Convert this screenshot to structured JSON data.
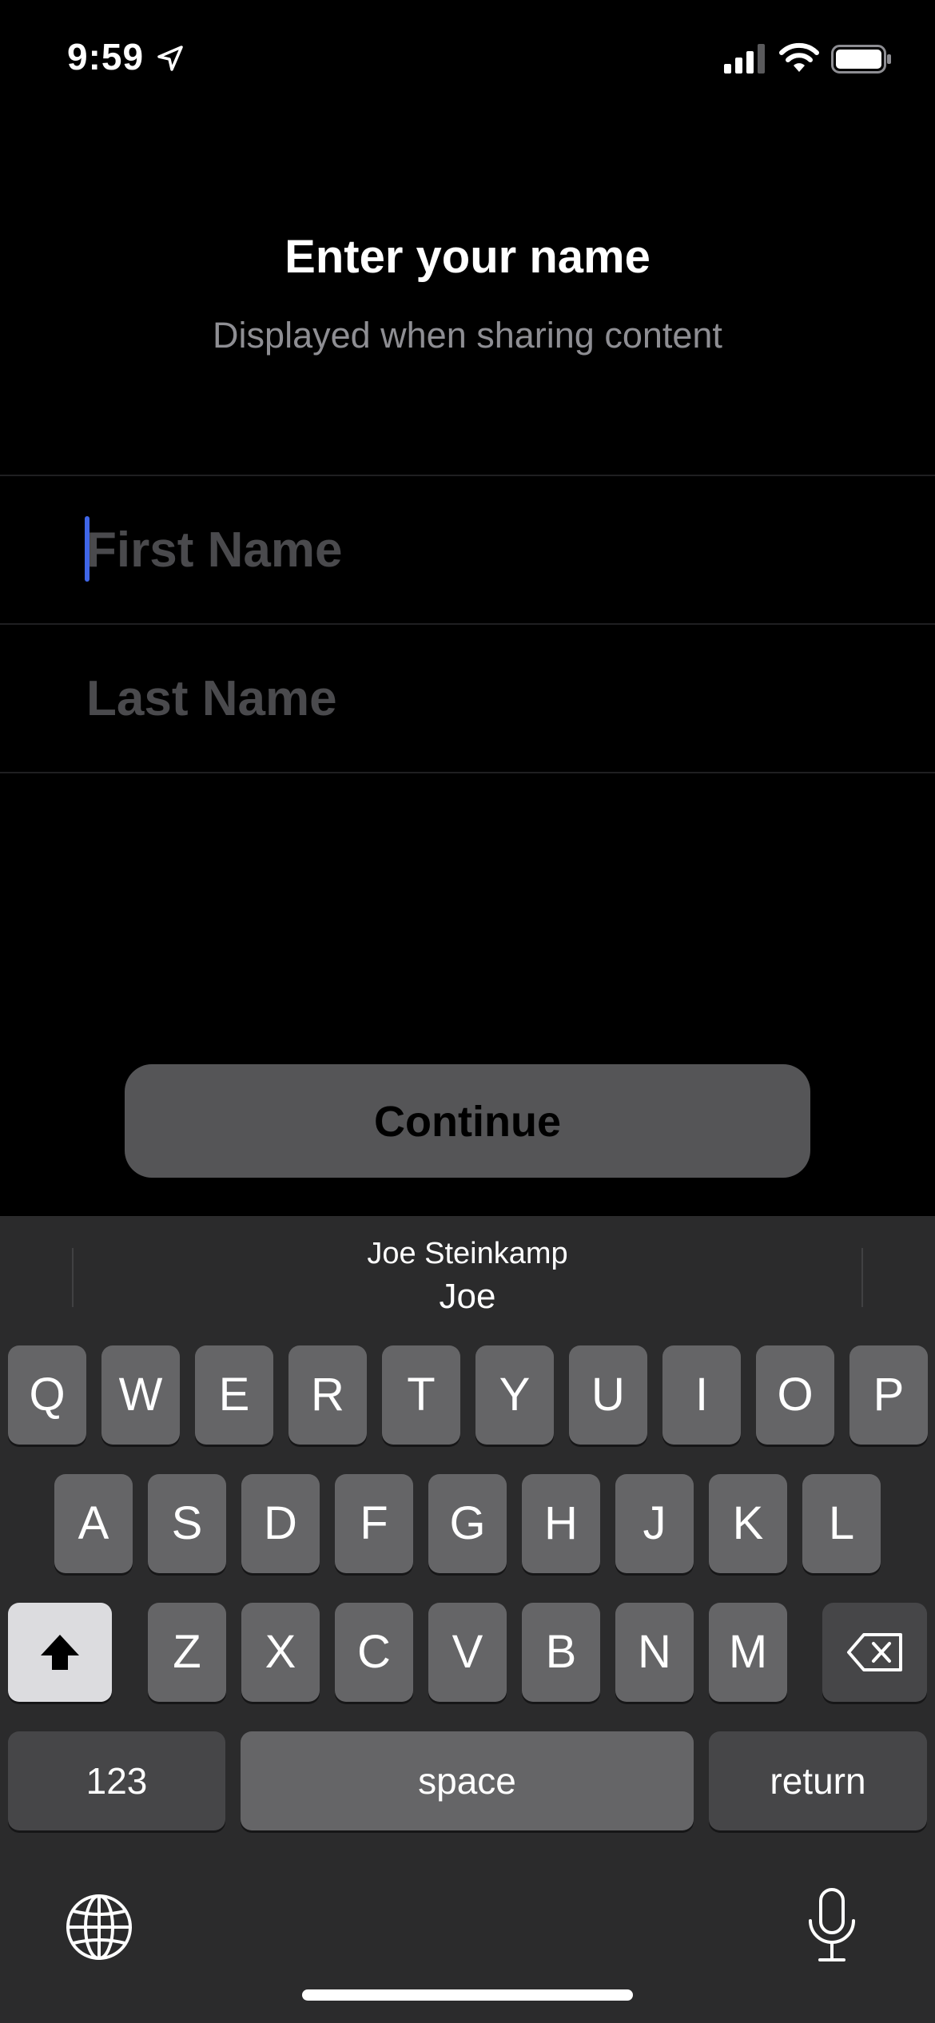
{
  "status_bar": {
    "time": "9:59",
    "icons": [
      "location-arrow-icon",
      "cellular-signal-icon",
      "wifi-icon",
      "battery-icon"
    ]
  },
  "header": {
    "title": "Enter your name",
    "subtitle": "Displayed when sharing content"
  },
  "form": {
    "first_name": {
      "value": "",
      "placeholder": "First Name"
    },
    "last_name": {
      "value": "",
      "placeholder": "Last Name"
    }
  },
  "continue_button": {
    "label": "Continue"
  },
  "keyboard": {
    "suggestions": {
      "contact": "Joe Steinkamp",
      "name": "Joe"
    },
    "row1": [
      "Q",
      "W",
      "E",
      "R",
      "T",
      "Y",
      "U",
      "I",
      "O",
      "P"
    ],
    "row2": [
      "A",
      "S",
      "D",
      "F",
      "G",
      "H",
      "J",
      "K",
      "L"
    ],
    "row3": [
      "Z",
      "X",
      "C",
      "V",
      "B",
      "N",
      "M"
    ],
    "numbers_key": "123",
    "space_key": "space",
    "return_key": "return",
    "icons": [
      "shift-icon",
      "backspace-icon",
      "globe-icon",
      "microphone-icon"
    ]
  },
  "colors": {
    "background": "#000000",
    "caret": "#3f66e8",
    "keyboard_background": "#2b2b2c",
    "key": "#656567",
    "button": "#555557"
  }
}
